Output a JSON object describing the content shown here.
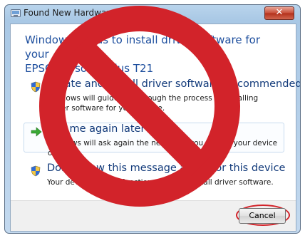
{
  "window": {
    "title": "Found New Hardware",
    "close_glyph": "✕"
  },
  "heading_line1": "Windows needs to install driver software for your",
  "heading_line2": "EPSONEpson Stylus T21",
  "options": [
    {
      "title": "Locate and install driver software (recommended)",
      "desc": "Windows will guide you through the process of installing driver software for your device.",
      "icon": "shield-icon"
    },
    {
      "title": "Ask me again later",
      "desc": "Windows will ask again the next time you plug in your device or log on.",
      "icon": "green-arrow-icon"
    },
    {
      "title": "Don't show this message again for this device",
      "desc": "Your device will not function until you install driver software.",
      "icon": "shield-icon"
    }
  ],
  "footer": {
    "cancel_label": "Cancel"
  },
  "colors": {
    "heading": "#1e4f9e",
    "prohibition_sign": "#d2232a",
    "selected_border": "#c7dbef"
  }
}
